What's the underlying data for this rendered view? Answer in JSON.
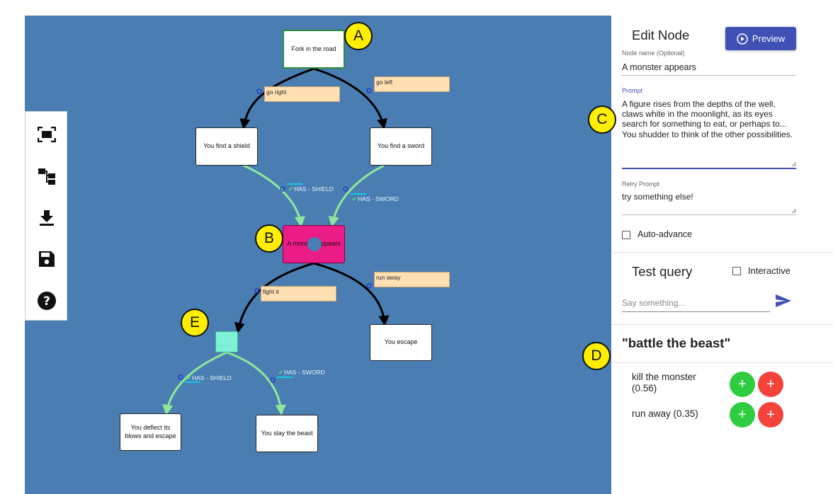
{
  "graph": {
    "nodes": {
      "fork": "Fork in the road",
      "shield": "You find a shield",
      "sword": "You find a sword",
      "monster": "A monster appears",
      "escape": "You escape",
      "deflect": "You deflect its blows and escape",
      "slay": "You slay the beast"
    },
    "edge_labels": {
      "go_right": "go right",
      "go_left": "go left",
      "fight_it": "fight it",
      "run_away": "run away"
    },
    "conditions": {
      "has_shield_1": "HAS - SHIELD",
      "has_sword_1": "HAS - SWORD",
      "has_shield_2": "HAS - SHIELD",
      "has_sword_2": "HAS - SWORD"
    },
    "colors": {
      "canvas_bg": "#4a7eb2",
      "selected_node": "#ec1c86",
      "empty_node": "#7ff0d6",
      "conditional_edge": "#8fe89a",
      "edge_label_bg": "#ffe0b3"
    }
  },
  "callouts": {
    "a": "A",
    "b": "B",
    "c": "C",
    "d": "D",
    "e": "E"
  },
  "toolbar": {
    "icons": [
      "fit-view-icon",
      "layout-tree-icon",
      "download-icon",
      "save-icon",
      "help-icon"
    ]
  },
  "edit_node": {
    "title": "Edit Node",
    "preview_label": "Preview",
    "node_name_label": "Node name (Optional)",
    "node_name_value": "A monster appears",
    "prompt_label": "Prompt",
    "prompt_value": "A figure rises from the depths of the well, claws white in the moonlight, as its eyes search for something to eat, or perhaps to...  You shudder to think of the other possibilities.",
    "retry_label": "Retry Prompt",
    "retry_value": "try something else!",
    "auto_advance_label": "Auto-advance"
  },
  "test_query": {
    "title": "Test query",
    "interactive_label": "Interactive",
    "input_placeholder": "Say something...",
    "query_text": "\"battle the beast\"",
    "results": [
      {
        "label": "kill the monster (0.56)"
      },
      {
        "label": "run away (0.35)"
      }
    ]
  }
}
